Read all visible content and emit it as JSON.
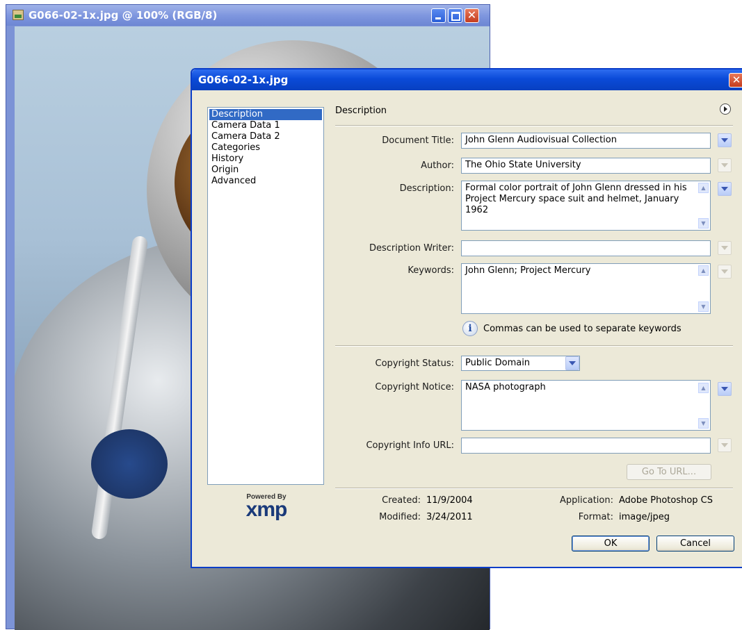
{
  "background_window": {
    "title": "G066-02-1x.jpg @ 100% (RGB/8)",
    "close_glyph": "✕"
  },
  "bottom_text": "...",
  "dialog": {
    "title": "G066-02-1x.jpg",
    "close_glyph": "✕",
    "panels": [
      "Description",
      "Camera Data 1",
      "Camera Data 2",
      "Categories",
      "History",
      "Origin",
      "Advanced"
    ],
    "selected_panel": "Description",
    "section_title": "Description",
    "fields": {
      "document_title": {
        "label": "Document Title:",
        "value": "John Glenn Audiovisual Collection"
      },
      "author": {
        "label": "Author:",
        "value": "The Ohio State University"
      },
      "description": {
        "label": "Description:",
        "value": "Formal color portrait of John Glenn dressed in his Project Mercury space suit and helmet, January 1962"
      },
      "description_writer": {
        "label": "Description Writer:",
        "value": ""
      },
      "keywords": {
        "label": "Keywords:",
        "value": "John Glenn; Project Mercury"
      },
      "keywords_hint": "Commas can be used to separate keywords",
      "copyright_status": {
        "label": "Copyright Status:",
        "value": "Public Domain"
      },
      "copyright_notice": {
        "label": "Copyright Notice:",
        "value": "NASA photograph"
      },
      "copyright_url": {
        "label": "Copyright Info URL:",
        "value": ""
      }
    },
    "go_to_url_label": "Go To URL...",
    "info": {
      "created_label": "Created:",
      "created_value": "11/9/2004",
      "modified_label": "Modified:",
      "modified_value": "3/24/2011",
      "application_label": "Application:",
      "application_value": "Adobe Photoshop CS",
      "format_label": "Format:",
      "format_value": "image/jpeg"
    },
    "ok_label": "OK",
    "cancel_label": "Cancel",
    "xmp_powered": "Powered By",
    "xmp_logo": "xmp"
  }
}
